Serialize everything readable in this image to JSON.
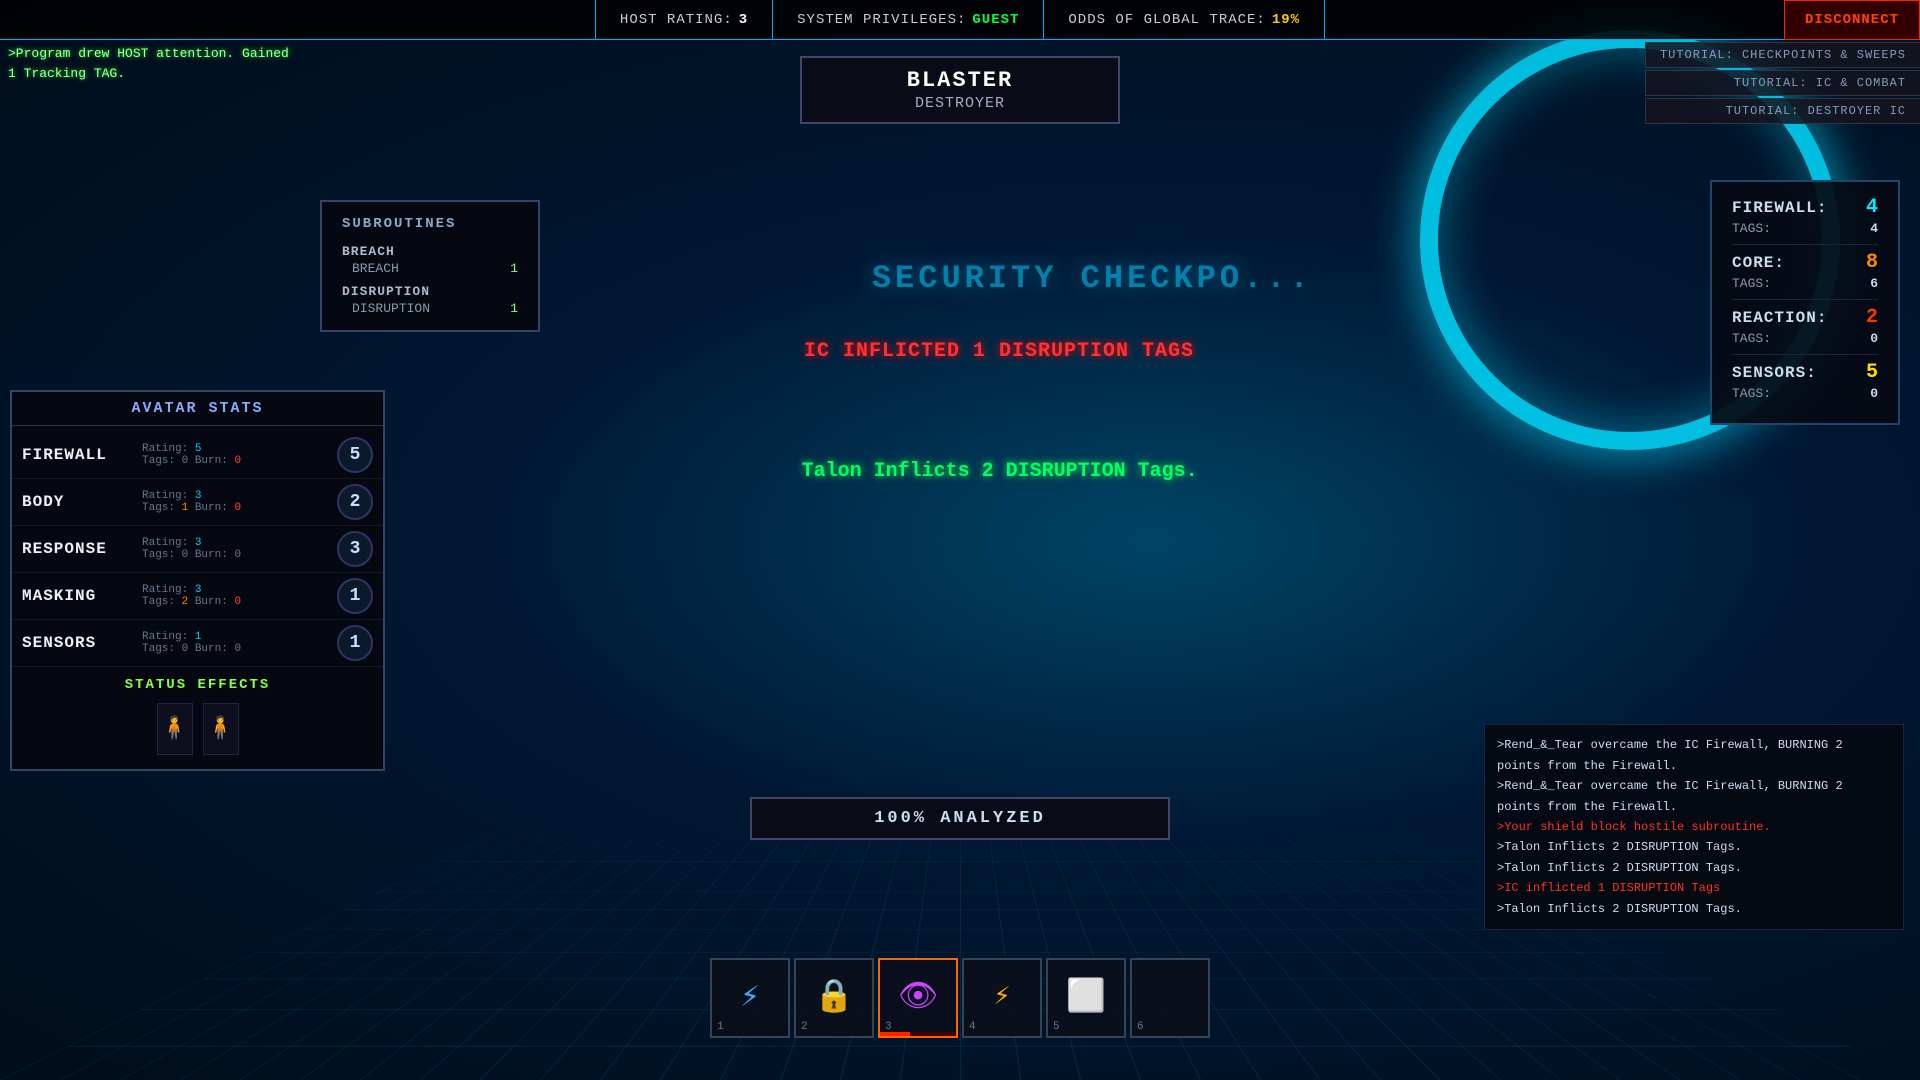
{
  "top_bar": {
    "host_rating_label": "HOST Rating:",
    "host_rating_val": "3",
    "sys_priv_label": "System Privileges:",
    "sys_priv_val": "GUEST",
    "trace_label": "Odds of Global Trace:",
    "trace_val": "19%",
    "disconnect_label": "Disconnect"
  },
  "top_log": {
    "line1": ">Program drew HOST attention. Gained",
    "line2": "1 Tracking TAG."
  },
  "entity": {
    "name": "Blaster",
    "type": "Destroyer"
  },
  "tutorials": [
    {
      "label": "Tutorial: Checkpoints & Sweeps"
    },
    {
      "label": "Tutorial: IC & Combat"
    },
    {
      "label": "Tutorial: Destroyer IC"
    }
  ],
  "host_stats": {
    "firewall_label": "Firewall:",
    "firewall_val": "4",
    "firewall_tags_label": "TAGS:",
    "firewall_tags_val": "4",
    "core_label": "Core:",
    "core_val": "8",
    "core_tags_label": "TAGS:",
    "core_tags_val": "6",
    "reaction_label": "Reaction:",
    "reaction_val": "2",
    "reaction_tags_label": "TAGS:",
    "reaction_tags_val": "0",
    "sensors_label": "Sensors:",
    "sensors_val": "5",
    "sensors_tags_label": "TAGS:",
    "sensors_tags_val": "0"
  },
  "subroutines": {
    "title": "Subroutines",
    "categories": [
      {
        "name": "Breach",
        "items": [
          {
            "name": "Breach",
            "count": "1"
          }
        ]
      },
      {
        "name": "Disruption",
        "items": [
          {
            "name": "Disruption",
            "count": "1"
          }
        ]
      }
    ]
  },
  "combat_messages": {
    "msg1": "IC inflicted 1 DISRUPTION Tags",
    "msg2": "Talon Inflicts 2 DISRUPTION Tags."
  },
  "security_checkpoint": "SECURITY CHECKPO...",
  "analysis": {
    "text": "100% Analyzed"
  },
  "avatar": {
    "title": "Avatar Stats",
    "stats": [
      {
        "name": "Firewall",
        "rating": "5",
        "tags": "0",
        "burn": "0",
        "ball_val": "5"
      },
      {
        "name": "Body",
        "rating": "3",
        "tags": "1",
        "burn": "0",
        "ball_val": "2"
      },
      {
        "name": "Response",
        "rating": "3",
        "tags": "0",
        "burn": "0",
        "ball_val": "3"
      },
      {
        "name": "Masking",
        "rating": "3",
        "tags": "2",
        "burn": "0",
        "ball_val": "1"
      },
      {
        "name": "Sensors",
        "rating": "1",
        "tags": "0",
        "burn": "0",
        "ball_val": "1"
      }
    ],
    "status_effects_label": "Status Effects"
  },
  "hotbar": {
    "slots": [
      {
        "num": "1",
        "icon": "⚡",
        "color": "#44aaff",
        "active": false,
        "bar_pct": 0
      },
      {
        "num": "2",
        "icon": "🔒",
        "color": "#aaaaaa",
        "active": false,
        "bar_pct": 0
      },
      {
        "num": "3",
        "icon": "👁",
        "color": "#cc44ff",
        "active": true,
        "bar_pct": 40
      },
      {
        "num": "4",
        "icon": "⚡",
        "color": "#ffaa00",
        "active": false,
        "bar_pct": 0
      },
      {
        "num": "5",
        "icon": "◻",
        "color": "#888888",
        "active": false,
        "bar_pct": 0
      },
      {
        "num": "6",
        "icon": "",
        "color": "#333333",
        "active": false,
        "bar_pct": 0
      }
    ]
  },
  "battle_log": {
    "lines": [
      {
        "text": ">Rend_&_Tear overcame the IC Firewall, BURNING  2 points from the Firewall.",
        "type": "normal"
      },
      {
        "text": ">Rend_&_Tear overcame the IC Firewall, BURNING  2 points from the Firewall.",
        "type": "normal"
      },
      {
        "text": ">Your shield block hostile subroutine.",
        "type": "red"
      },
      {
        "text": ">Talon Inflicts 2 DISRUPTION Tags.",
        "type": "normal"
      },
      {
        "text": ">Talon Inflicts 2 DISRUPTION Tags.",
        "type": "normal"
      },
      {
        "text": ">IC inflicted 1 DISRUPTION Tags",
        "type": "red"
      },
      {
        "text": ">Talon Inflicts 2 DISRUPTION Tags.",
        "type": "normal"
      }
    ]
  }
}
